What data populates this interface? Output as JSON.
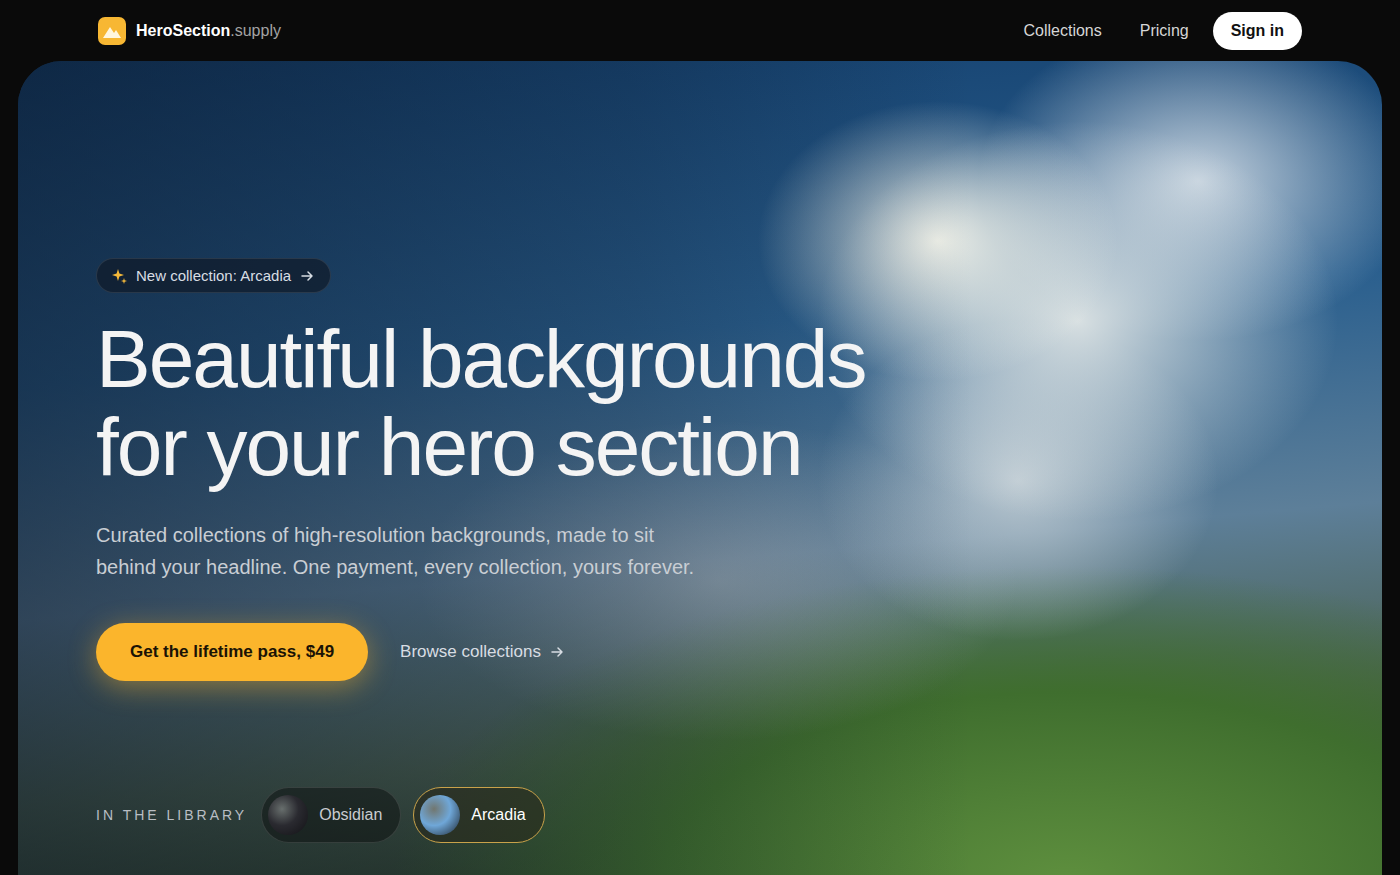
{
  "brand": {
    "name": "HeroSection",
    "suffix": ".supply"
  },
  "nav": {
    "links": [
      "Collections",
      "Pricing"
    ],
    "cta": "Sign in"
  },
  "hero": {
    "badge": "New collection: Arcadia",
    "headline": [
      "Beautiful backgrounds",
      "for your hero section"
    ],
    "description": [
      "Curated collections of high-resolution backgrounds, made to sit",
      "behind your headline. One payment, every collection, yours forever."
    ],
    "primary": "Get the lifetime pass, $49",
    "secondary": "Browse collections"
  },
  "library": {
    "label": "IN THE LIBRARY",
    "items": [
      {
        "name": "Obsidian",
        "selected": false,
        "color": "#2a2a30"
      },
      {
        "name": "Arcadia",
        "selected": true,
        "color": "#6fa7d8"
      }
    ]
  }
}
